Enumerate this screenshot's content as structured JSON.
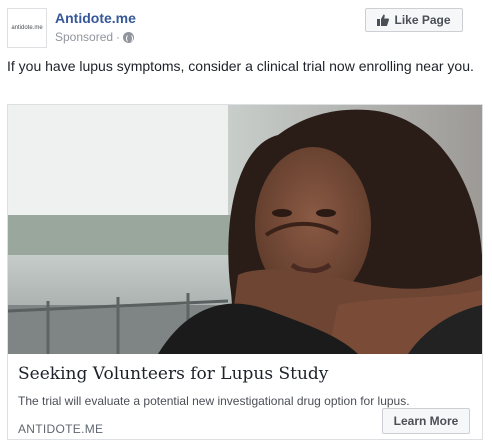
{
  "header": {
    "avatar_text": "antidote.me",
    "page_name": "Antidote.me",
    "sponsored": "Sponsored",
    "separator": "·",
    "privacy_icon": "globe-icon",
    "like_label": "Like Page",
    "like_icon": "thumbs-up-icon"
  },
  "post": {
    "text": "If you have lupus symptoms, consider a clinical trial now enrolling near you."
  },
  "card": {
    "image_description_icon": "photo",
    "title": "Seeking Volunteers for Lupus Study",
    "description": "The trial will evaluate a potential new investigational drug option for lupus.",
    "domain": "ANTIDOTE.ME",
    "cta_label": "Learn More"
  },
  "colors": {
    "link_blue": "#365899",
    "meta_gray": "#90949c",
    "border": "#dddfe2",
    "button_bg": "#f6f7f9",
    "brand_green": "#9bd33b"
  }
}
